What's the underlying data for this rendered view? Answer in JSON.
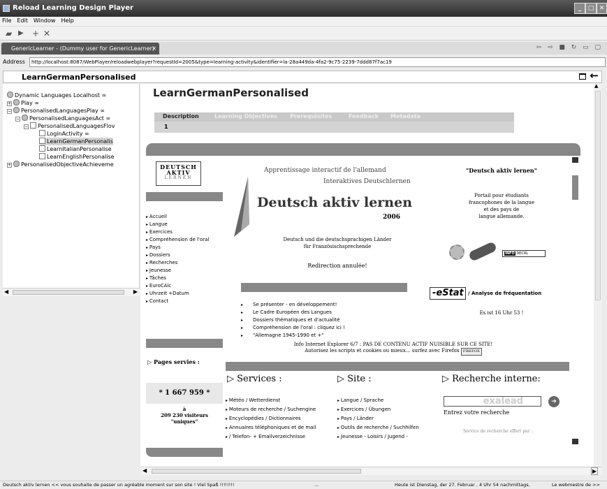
{
  "window": {
    "title": "Reload Learning Design Player"
  },
  "menu": [
    "File",
    "Edit",
    "Window",
    "Help"
  ],
  "tab": {
    "label": "GenericLearner - (Dummy user for GenericLearner)",
    "close": "✕"
  },
  "address": {
    "label": "Address",
    "url": "http://localhost:8087/WebPlayer/reloadwebplayer?requestId=2005&type=learning-activity&identifier=la-28a449da-4fa2-9c75-2239-7ddd87f7ac19"
  },
  "pane": {
    "title": "LearnGermanPersonalised"
  },
  "tree": [
    {
      "label": "Dynamic Languages Localhost ∞"
    },
    {
      "label": "Play ∞"
    },
    {
      "label": "PersonalisedLanguagesPlay ∞"
    },
    {
      "label": "PersonalisedLanguagesAct ∞"
    },
    {
      "label": "PersonalisedLanguagesFlov"
    },
    {
      "label": "LoginActivity ∞"
    },
    {
      "label": "LearnGermanPersonalis"
    },
    {
      "label": "LearnItalianPersonalise"
    },
    {
      "label": "LearnEnglishPersonalise"
    },
    {
      "label": "PersonalisedObjectiveAchieveme"
    }
  ],
  "content": {
    "title": "LearnGermanPersonalised",
    "tabs": [
      "Description",
      "Learning Objectives",
      "Prerequisites",
      "Feedback",
      "Metadata"
    ],
    "number": "1"
  },
  "site": {
    "logo_top": "DEUTSCH",
    "logo_mid": "AKTIV",
    "logo_bottom": "LERNEN",
    "nav": [
      "Accueil",
      "Langue",
      "Exercices",
      "Compréhension de l'oral",
      "Pays",
      "Dossiers",
      "Recherches",
      "Jeunesse",
      "Tâches",
      "EuroCAlc",
      "Uhrzeit +Datum",
      "Contact"
    ],
    "pages_served": "Pages servies :",
    "counter": "* 1 667 959 *",
    "visitors_a": "à",
    "visitors_b": "209 230 visiteurs",
    "visitors_c": "\"uniques\"",
    "app_fr": "Apprentissage interactif de l'allemand",
    "app_de": "Interaktives Deutschlernen",
    "headline": "Deutsch aktiv lernen",
    "year": "2006",
    "desc_line1": "Deutsch und die deutschsprachigen Länder",
    "desc_line2": "für Französischsprechende",
    "redirect": "Redirection annulée!",
    "right_title": "\"Deutsch aktiv lernen\"",
    "right_desc1": "Portail pour étudiants",
    "right_desc2": "francophones de la langue",
    "right_desc3": "et des pays de",
    "right_desc4": "langue allemande.",
    "info_label": "INFO",
    "info_box": "DECRL",
    "estat": "-eStat",
    "estat_text": "/ Analyse de fréquentation",
    "es_ist": "Es ist 16 Uhr 53 !",
    "bullets": [
      "Se présenter - en développement!",
      "Le Cadre Européen des Langues",
      "Dossiers thématiques et d'actualité",
      "Compréhension de l'oral : cliquez ici !",
      "\"Allemagne 1945-1990 et +\""
    ],
    "ie_info1": "Info Internet Explorer 6/7 : PAS DE CONTENU ACTIF NUISIBLE SUR CE SITE!",
    "ie_info2": "Autorisez les scripts et cookies ou mieux... surfez avec Firefox",
    "firefox": "FIREFOX",
    "services_h": "▷ Services :",
    "site_h": "▷ Site :",
    "search_h": "▷ Recherche interne:",
    "services": [
      "Météo / Wetterdienst",
      "Moteurs de recherche / Suchengine",
      "Encyclopédies / Dictionnaires",
      "Annuaires téléphoniques et de mail",
      "/ Telefon- + Emailverzeichnisse"
    ],
    "site_items": [
      "Langue / Sprache",
      "Exercices / Übungen",
      "Pays / Länder",
      "Outils de recherche / Suchhilfen",
      "Jeunesse - Loisirs / Jugend -"
    ],
    "search_placeholder": "exalead",
    "entrez": "Entrez votre recherche",
    "offert": "Service de recherche offert par :"
  },
  "status": {
    "left": "Deutsch aktiv lernen << vous souhaite de passer un agréable moment sur son site ! Viel Spaß !!!!!!!!",
    "mid": "...",
    "right": "Heute ist Dienstag, der 27. Februar , 4 Uhr 54 nachmittags,",
    "far": "Le webmestre de >>"
  }
}
